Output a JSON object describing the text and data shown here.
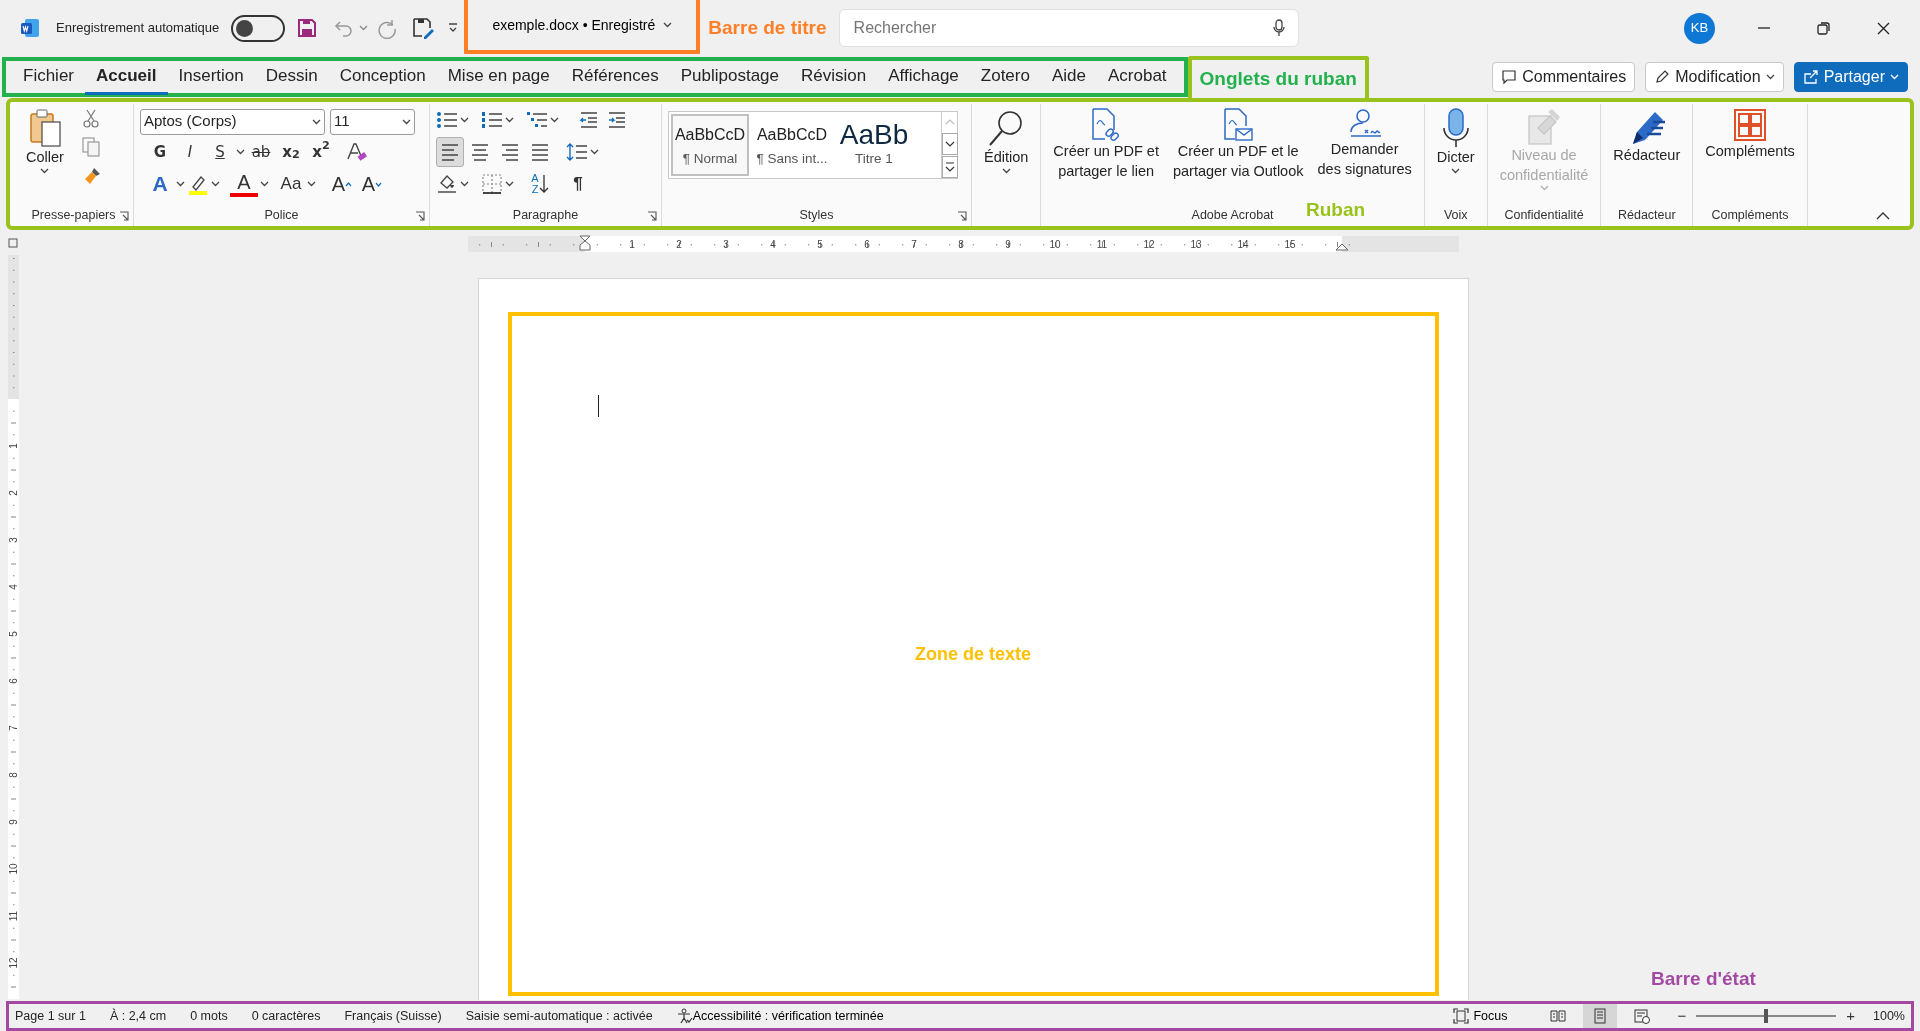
{
  "title_bar": {
    "autosave_label": "Enregistrement automatique",
    "autosave_on": false,
    "document_title": "exemple.docx • Enregistré",
    "search": {
      "placeholder": "Rechercher"
    },
    "avatar": "KB",
    "annotation": {
      "text": "Barre de titre",
      "color": "#ff7f27"
    }
  },
  "ribbon_tabs": {
    "tabs": [
      {
        "label": "Fichier",
        "selected": false
      },
      {
        "label": "Accueil",
        "selected": true
      },
      {
        "label": "Insertion",
        "selected": false
      },
      {
        "label": "Dessin",
        "selected": false
      },
      {
        "label": "Conception",
        "selected": false
      },
      {
        "label": "Mise en page",
        "selected": false
      },
      {
        "label": "Références",
        "selected": false
      },
      {
        "label": "Publipostage",
        "selected": false
      },
      {
        "label": "Révision",
        "selected": false
      },
      {
        "label": "Affichage",
        "selected": false
      },
      {
        "label": "Zotero",
        "selected": false
      },
      {
        "label": "Aide",
        "selected": false
      },
      {
        "label": "Acrobat",
        "selected": false
      }
    ],
    "annotation": {
      "text": "Onglets du ruban",
      "color": "#22b14c"
    }
  },
  "actions": [
    {
      "label": "Commentaires",
      "kind": "outline"
    },
    {
      "label": "Modification",
      "kind": "dropdown"
    },
    {
      "label": "Partager",
      "kind": "primary"
    }
  ],
  "ribbon": {
    "annotation": {
      "text": "Ruban",
      "color": "#99c31c"
    },
    "groups": [
      {
        "kind": "clipboard",
        "label": "Presse-papiers",
        "paste": "Coller"
      },
      {
        "kind": "font",
        "label": "Police",
        "font_name": "Aptos (Corps)",
        "font_size": "11",
        "format_buttons": [
          "G",
          "I",
          "S",
          "ab",
          "x$_{2}$",
          "x$^{2}$"
        ],
        "effect_buttons": [
          "A",
          "A",
          "Aa",
          "A",
          "A"
        ]
      },
      {
        "kind": "paragraph",
        "label": "Paragraphe",
        "alignments": [
          {
            "selected": true
          },
          {
            "selected": false
          },
          {
            "selected": false
          },
          {
            "selected": false
          }
        ],
        "sort_letters": [
          "A",
          "Z"
        ],
        "pilcrow": "¶"
      },
      {
        "kind": "styles",
        "label": "Styles",
        "items": [
          {
            "preview": "AaBbCcD",
            "name": "¶ Normal",
            "selected": true
          },
          {
            "preview": "AaBbCcD",
            "name": "¶ Sans int...",
            "selected": false
          },
          {
            "preview": "AaBb",
            "name": "Titre 1",
            "selected": false
          }
        ]
      },
      {
        "kind": "large",
        "buttons": [
          {
            "label": "Édition",
            "dropdown": true,
            "disabled": false
          }
        ]
      },
      {
        "kind": "large",
        "label": "Adobe Acrobat",
        "buttons": [
          {
            "label": "Créer un PDF et\npartager le lien",
            "dropdown": false,
            "disabled": false
          },
          {
            "label": "Créer un PDF et le\npartager via Outlook",
            "dropdown": false,
            "disabled": false
          },
          {
            "label": "Demander\ndes signatures",
            "dropdown": false,
            "disabled": false
          }
        ]
      },
      {
        "kind": "large",
        "label": "Voix",
        "buttons": [
          {
            "label": "Dicter",
            "dropdown": true,
            "disabled": false
          }
        ]
      },
      {
        "kind": "large",
        "label": "Confidentialité",
        "buttons": [
          {
            "label": "Niveau de\nconfidentialité",
            "dropdown": true,
            "disabled": true
          }
        ]
      },
      {
        "kind": "large",
        "label": "Rédacteur",
        "buttons": [
          {
            "label": "Rédacteur",
            "dropdown": false,
            "disabled": false
          }
        ]
      },
      {
        "kind": "large",
        "label": "Compléments",
        "buttons": [
          {
            "label": "Compléments",
            "dropdown": false,
            "disabled": false
          }
        ]
      }
    ]
  },
  "horizontal_ruler": [
    "1",
    "2",
    "3",
    "4",
    "5",
    "6",
    "7",
    "8",
    "9",
    "10",
    "11",
    "12",
    "13",
    "14",
    "15"
  ],
  "vertical_ruler": [
    "1",
    "2",
    "3",
    "4",
    "5",
    "6",
    "7",
    "8",
    "9",
    "10",
    "11",
    "12"
  ],
  "document": {
    "annotation": {
      "text": "Zone de texte",
      "color": "#ffc000"
    }
  },
  "status_bar": {
    "items": [
      "Page 1 sur 1",
      "À : 2,4 cm",
      "0 mots",
      "0 caractères",
      "Français (Suisse)",
      "Saisie semi-automatique : activée"
    ],
    "accessibility": "Accessibilité : vérification terminée",
    "focus": "Focus",
    "views": [
      {
        "selected": false
      },
      {
        "selected": true
      },
      {
        "selected": false
      }
    ],
    "zoom_out": "−",
    "zoom_in": "+",
    "zoom": {
      "level": 0.5
    },
    "zoom_reading": "100%",
    "annotation": {
      "text": "Barre d'état",
      "color": "#a349a4"
    }
  }
}
